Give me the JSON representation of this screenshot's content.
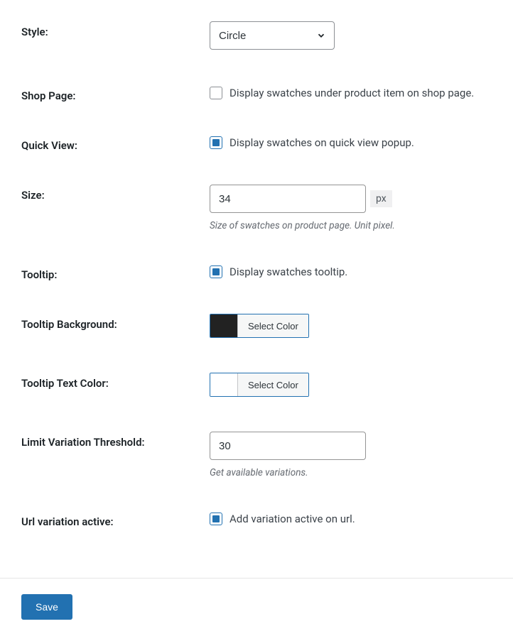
{
  "style": {
    "label": "Style:",
    "value": "Circle"
  },
  "shop_page": {
    "label": "Shop Page:",
    "checkbox_label": "Display swatches under product item on shop page.",
    "checked": false
  },
  "quick_view": {
    "label": "Quick View:",
    "checkbox_label": "Display swatches on quick view popup.",
    "checked": true
  },
  "size": {
    "label": "Size:",
    "value": "34",
    "unit": "px",
    "desc": "Size of swatches on product page. Unit pixel."
  },
  "tooltip": {
    "label": "Tooltip:",
    "checkbox_label": "Display swatches tooltip.",
    "checked": true
  },
  "tooltip_bg": {
    "label": "Tooltip Background:",
    "button": "Select Color",
    "color": "#222222"
  },
  "tooltip_text": {
    "label": "Tooltip Text Color:",
    "button": "Select Color",
    "color": "#ffffff"
  },
  "limit_threshold": {
    "label": "Limit Variation Threshold:",
    "value": "30",
    "desc": "Get available variations."
  },
  "url_variation": {
    "label": "Url variation active:",
    "checkbox_label": "Add variation active on url.",
    "checked": true
  },
  "save_label": "Save"
}
